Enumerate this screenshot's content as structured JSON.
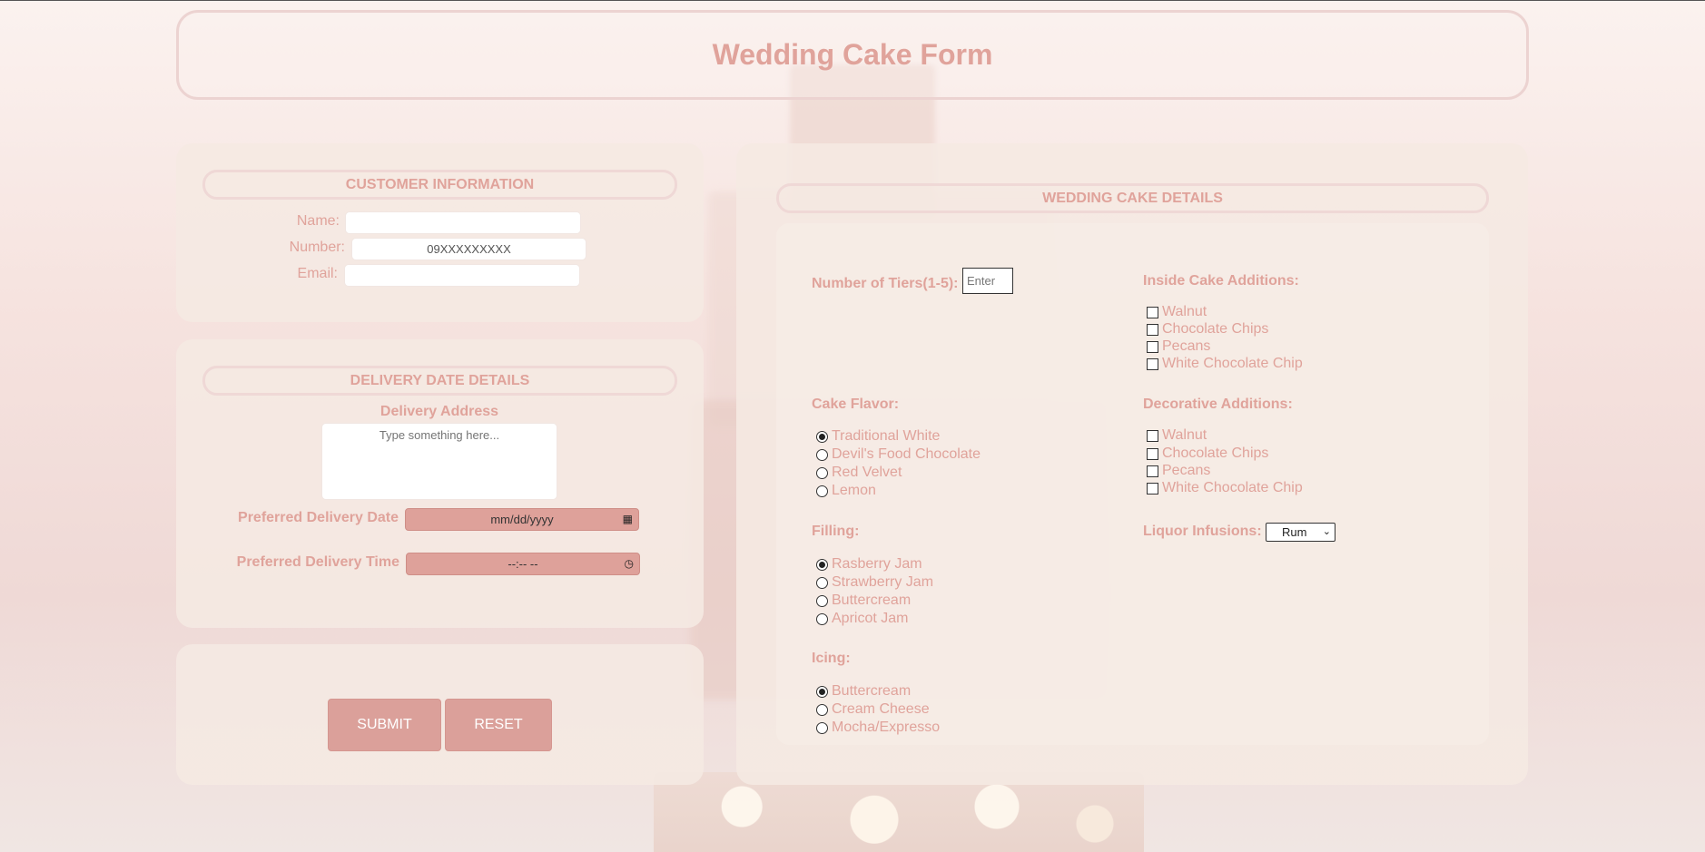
{
  "page": {
    "title": "Wedding Cake Form"
  },
  "customer": {
    "heading": "CUSTOMER INFORMATION",
    "name_label": "Name:",
    "name_value": "",
    "number_label": "Number:",
    "number_value": "09XXXXXXXXX",
    "email_label": "Email:",
    "email_value": ""
  },
  "delivery": {
    "heading": "DELIVERY DATE DETAILS",
    "address_label": "Delivery Address",
    "address_placeholder": "Type something here...",
    "date_label": "Preferred Delivery Date",
    "date_value": "mm/dd/yyyy",
    "time_label": "Preferred Delivery Time",
    "time_value": "--:-- --"
  },
  "actions": {
    "submit": "SUBMIT",
    "reset": "RESET"
  },
  "cake": {
    "heading": "WEDDING CAKE DETAILS",
    "tiers_label": "Number of Tiers(1-5):",
    "tiers_placeholder": "Enter",
    "flavor": {
      "title": "Cake Flavor:",
      "options": [
        "Traditional White",
        "Devil's Food Chocolate",
        "Red Velvet",
        "Lemon"
      ],
      "selected": 0
    },
    "filling": {
      "title": "Filling:",
      "options": [
        "Rasberry Jam",
        "Strawberry Jam",
        "Buttercream",
        "Apricot Jam"
      ],
      "selected": 0
    },
    "icing": {
      "title": "Icing:",
      "options": [
        "Buttercream",
        "Cream Cheese",
        "Mocha/Expresso"
      ],
      "selected": 0
    },
    "inside": {
      "title": "Inside Cake Additions:",
      "options": [
        "Walnut",
        "Chocolate Chips",
        "Pecans",
        "White Chocolate Chip"
      ]
    },
    "decorative": {
      "title": "Decorative Additions:",
      "options": [
        "Walnut",
        "Chocolate Chips",
        "Pecans",
        "White Chocolate Chip"
      ]
    },
    "liquor_label": "Liquor Infusions:",
    "liquor_value": "Rum"
  },
  "colors": {
    "accent": "#e0a39b",
    "button": "#dba09a",
    "panel": "#f5e9e2"
  }
}
